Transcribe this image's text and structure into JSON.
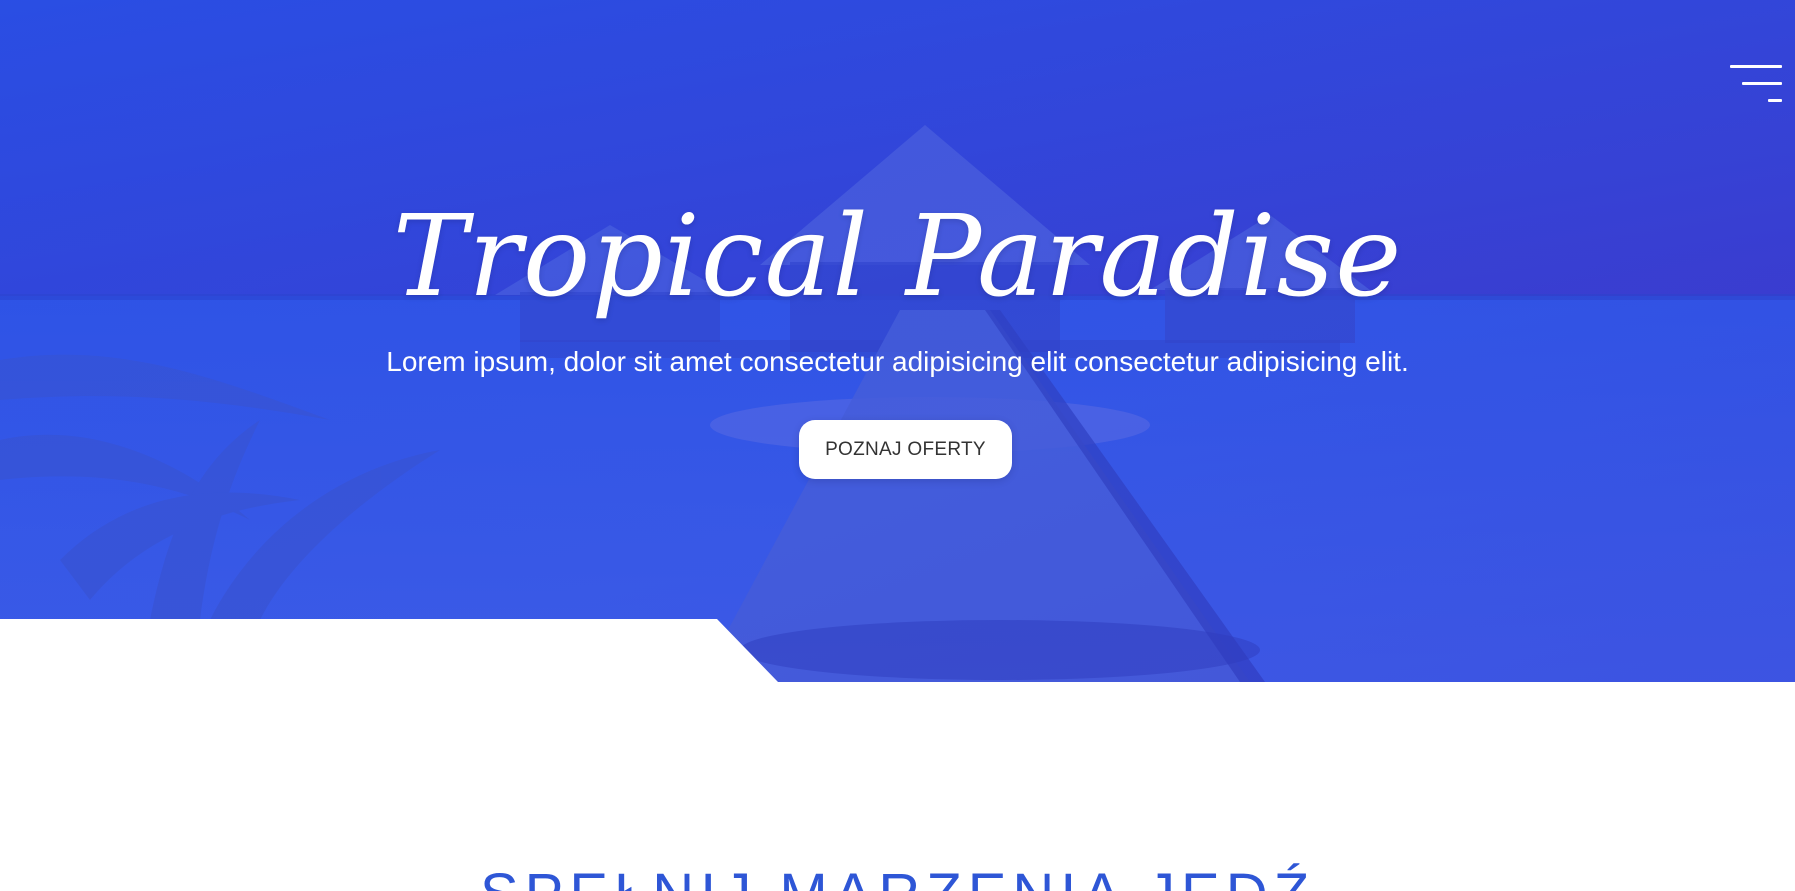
{
  "hero": {
    "title": "Tropical Paradise",
    "subtitle": "Lorem ipsum, dolor sit amet consectetur adipisicing elit consectetur adipisicing elit.",
    "cta_label": "POZNAJ OFERTY",
    "overlay_color": "#3454e6"
  },
  "nav": {
    "menu_icon": "hamburger-menu-icon"
  },
  "section": {
    "heading": "SPEŁNIJ MARZENIA JEDŹ"
  },
  "colors": {
    "accent": "#2e56d6",
    "button_bg": "#ffffff",
    "button_text": "#333333"
  }
}
